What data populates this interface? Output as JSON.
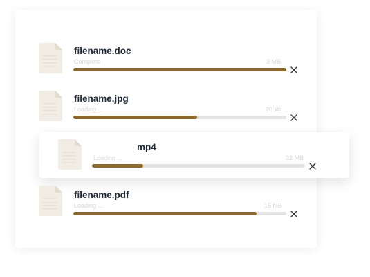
{
  "colors": {
    "progress_fill": "#8d6a2c",
    "progress_track": "#e2e2e2",
    "file_name": "#1f2a36",
    "muted_text": "#d5d5d5"
  },
  "uploads": [
    {
      "name": "filename.doc",
      "status": "Complete",
      "size": "3 MB",
      "progress": 1.0,
      "icon": "file-icon",
      "close_icon": "close-icon"
    },
    {
      "name": "filename.jpg",
      "status": "Loading ...",
      "size": "20 kb",
      "progress": 0.58,
      "icon": "file-icon",
      "close_icon": "close-icon"
    },
    {
      "name": "mp4",
      "status": "Loading ...",
      "size": "32 MB",
      "progress": 0.24,
      "icon": "file-icon",
      "close_icon": "close-icon"
    },
    {
      "name": "filename.pdf",
      "status": "Loading ...",
      "size": "15 MB",
      "progress": 0.86,
      "icon": "file-icon",
      "close_icon": "close-icon"
    }
  ]
}
